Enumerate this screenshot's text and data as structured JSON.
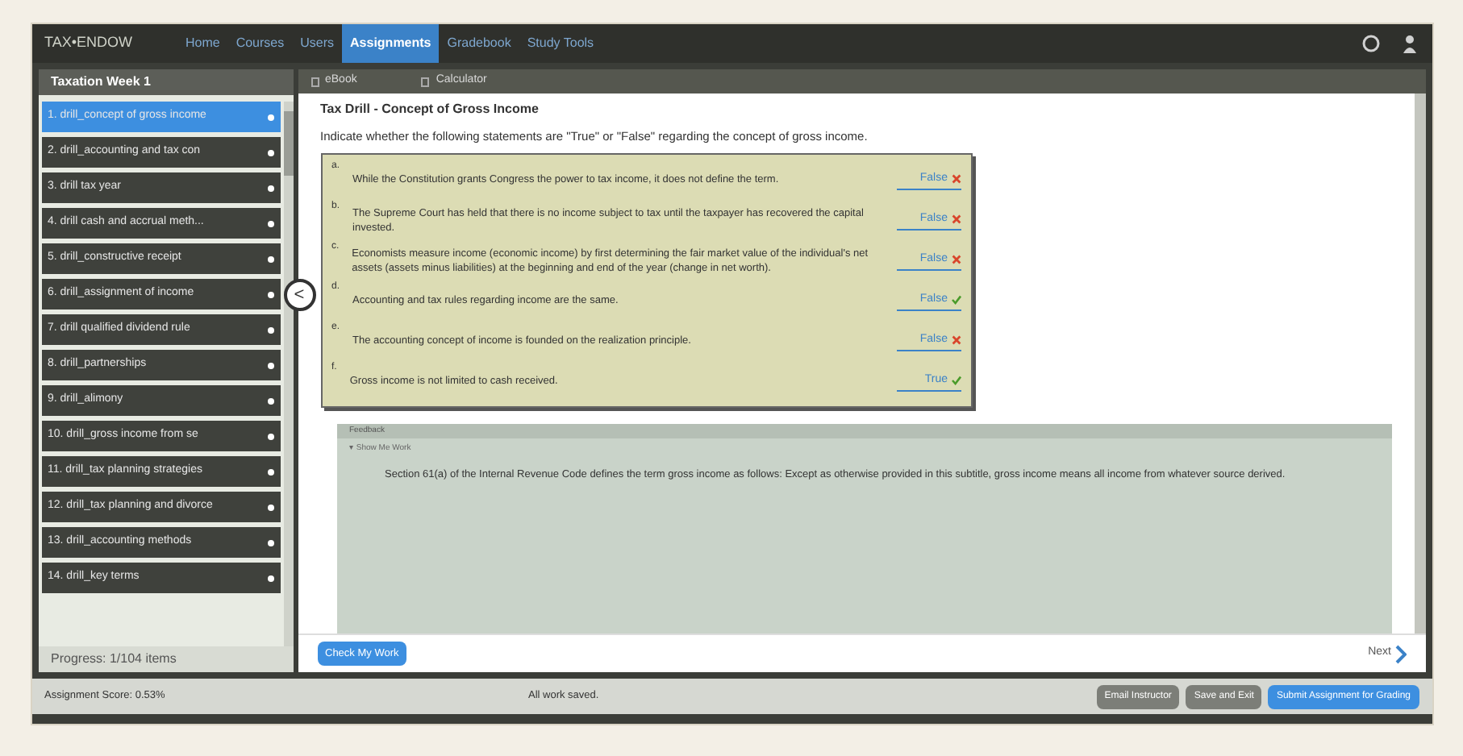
{
  "brand": "TAX•ENDOW",
  "nav": [
    {
      "label": "Home",
      "selected": false
    },
    {
      "label": "Courses",
      "selected": false
    },
    {
      "label": "Users",
      "selected": false
    },
    {
      "label": "Assignments",
      "selected": true
    },
    {
      "label": "Gradebook",
      "selected": false
    },
    {
      "label": "Study Tools",
      "selected": false
    }
  ],
  "sidebar": {
    "title": "Taxation Week 1",
    "items": [
      {
        "label": "1. drill_concept of gross income",
        "selected": true
      },
      {
        "label": "2. drill_accounting and tax con",
        "selected": false
      },
      {
        "label": "3. drill tax year",
        "selected": false
      },
      {
        "label": "4. drill cash and accrual meth...",
        "selected": false
      },
      {
        "label": "5. drill_constructive receipt",
        "selected": false
      },
      {
        "label": "6. drill_assignment of income",
        "selected": false
      },
      {
        "label": "7. drill qualified dividend rule",
        "selected": false
      },
      {
        "label": "8. drill_partnerships",
        "selected": false
      },
      {
        "label": "9. drill_alimony",
        "selected": false
      },
      {
        "label": "10. drill_gross income from se",
        "selected": false
      },
      {
        "label": "11. drill_tax planning strategies",
        "selected": false
      },
      {
        "label": "12. drill_tax planning and divorce",
        "selected": false
      },
      {
        "label": "13. drill_accounting methods",
        "selected": false
      },
      {
        "label": "14. drill_key terms",
        "selected": false
      }
    ],
    "progress": "Progress: 1/104 items",
    "collapse": "<"
  },
  "toolbar": [
    "eBook",
    "Calculator"
  ],
  "question": {
    "title": "Tax Drill - Concept of Gross Income",
    "prompt": "Indicate whether the following statements are \"True\" or \"False\" regarding the concept of gross income.",
    "statements": [
      {
        "letter": "a.",
        "text": "While the Constitution grants Congress the power to tax income, it does not define the term.",
        "answer": "False",
        "correct": false
      },
      {
        "letter": "b.",
        "text": "The Supreme Court has held that there is no income subject to tax until the taxpayer has recovered the capital invested.",
        "answer": "False",
        "correct": false
      },
      {
        "letter": "c.",
        "text": "Economists measure income (economic income) by first determining the fair market value of the individual's net assets (assets minus liabilities) at the beginning and end of the year (change in net worth).",
        "answer": "False",
        "correct": false
      },
      {
        "letter": "d.",
        "text": "Accounting and tax rules regarding income are the same.",
        "answer": "False",
        "correct": true
      },
      {
        "letter": "e.",
        "text": "The accounting concept of income is founded on the realization principle.",
        "answer": "False",
        "correct": false
      },
      {
        "letter": "f.",
        "text": "Gross income is not limited to cash received.",
        "answer": "True",
        "correct": true
      }
    ]
  },
  "feedback": {
    "title": "Feedback",
    "toggle": "▾ Show Me Work",
    "text": "Section 61(a) of the Internal Revenue Code defines the term gross income as follows: Except as otherwise provided in this subtitle, gross income means all income from whatever source derived."
  },
  "check_button": "Check My Work",
  "next": "Next",
  "footer": {
    "score": "Assignment Score: 0.53%",
    "status": "All work saved.",
    "buttons": [
      {
        "label": "Email Instructor",
        "primary": false
      },
      {
        "label": "Save and Exit",
        "primary": false
      },
      {
        "label": "Submit Assignment for Grading",
        "primary": true
      }
    ]
  }
}
